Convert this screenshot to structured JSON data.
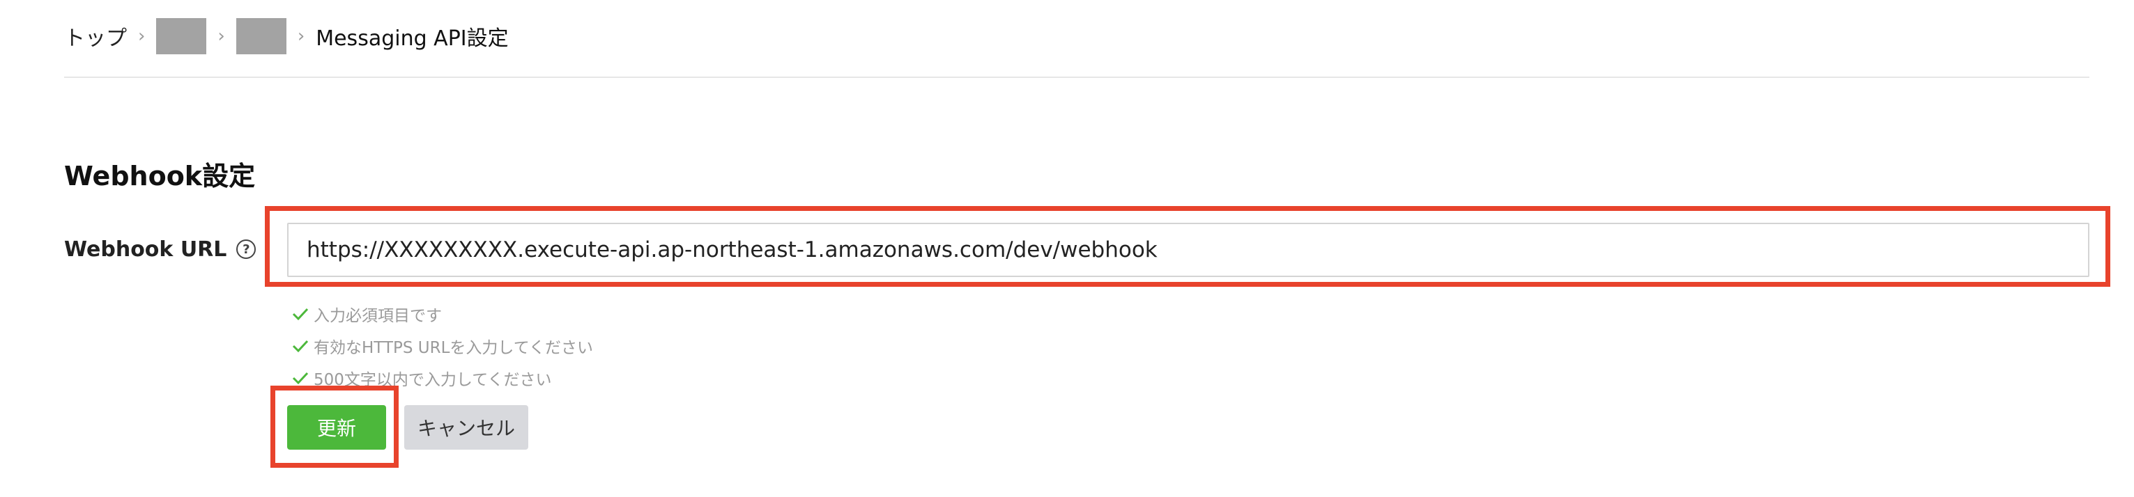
{
  "breadcrumb": {
    "items": [
      {
        "label": "トップ"
      },
      {
        "label": ""
      },
      {
        "label": ""
      },
      {
        "label": "Messaging API設定"
      }
    ],
    "separator": "›"
  },
  "section": {
    "title": "Webhook設定",
    "field_label": "Webhook URL",
    "help_glyph": "?",
    "url_value": "https://XXXXXXXXX.execute-api.ap-northeast-1.amazonaws.com/dev/webhook",
    "rules": [
      "入力必須項目です",
      "有効なHTTPS URLを入力してください",
      "500文字以内で入力してください"
    ]
  },
  "actions": {
    "update_label": "更新",
    "cancel_label": "キャンセル"
  },
  "colors": {
    "accent_green": "#4cb83b",
    "highlight_red": "#e8432c",
    "check_green": "#4cb83b"
  }
}
